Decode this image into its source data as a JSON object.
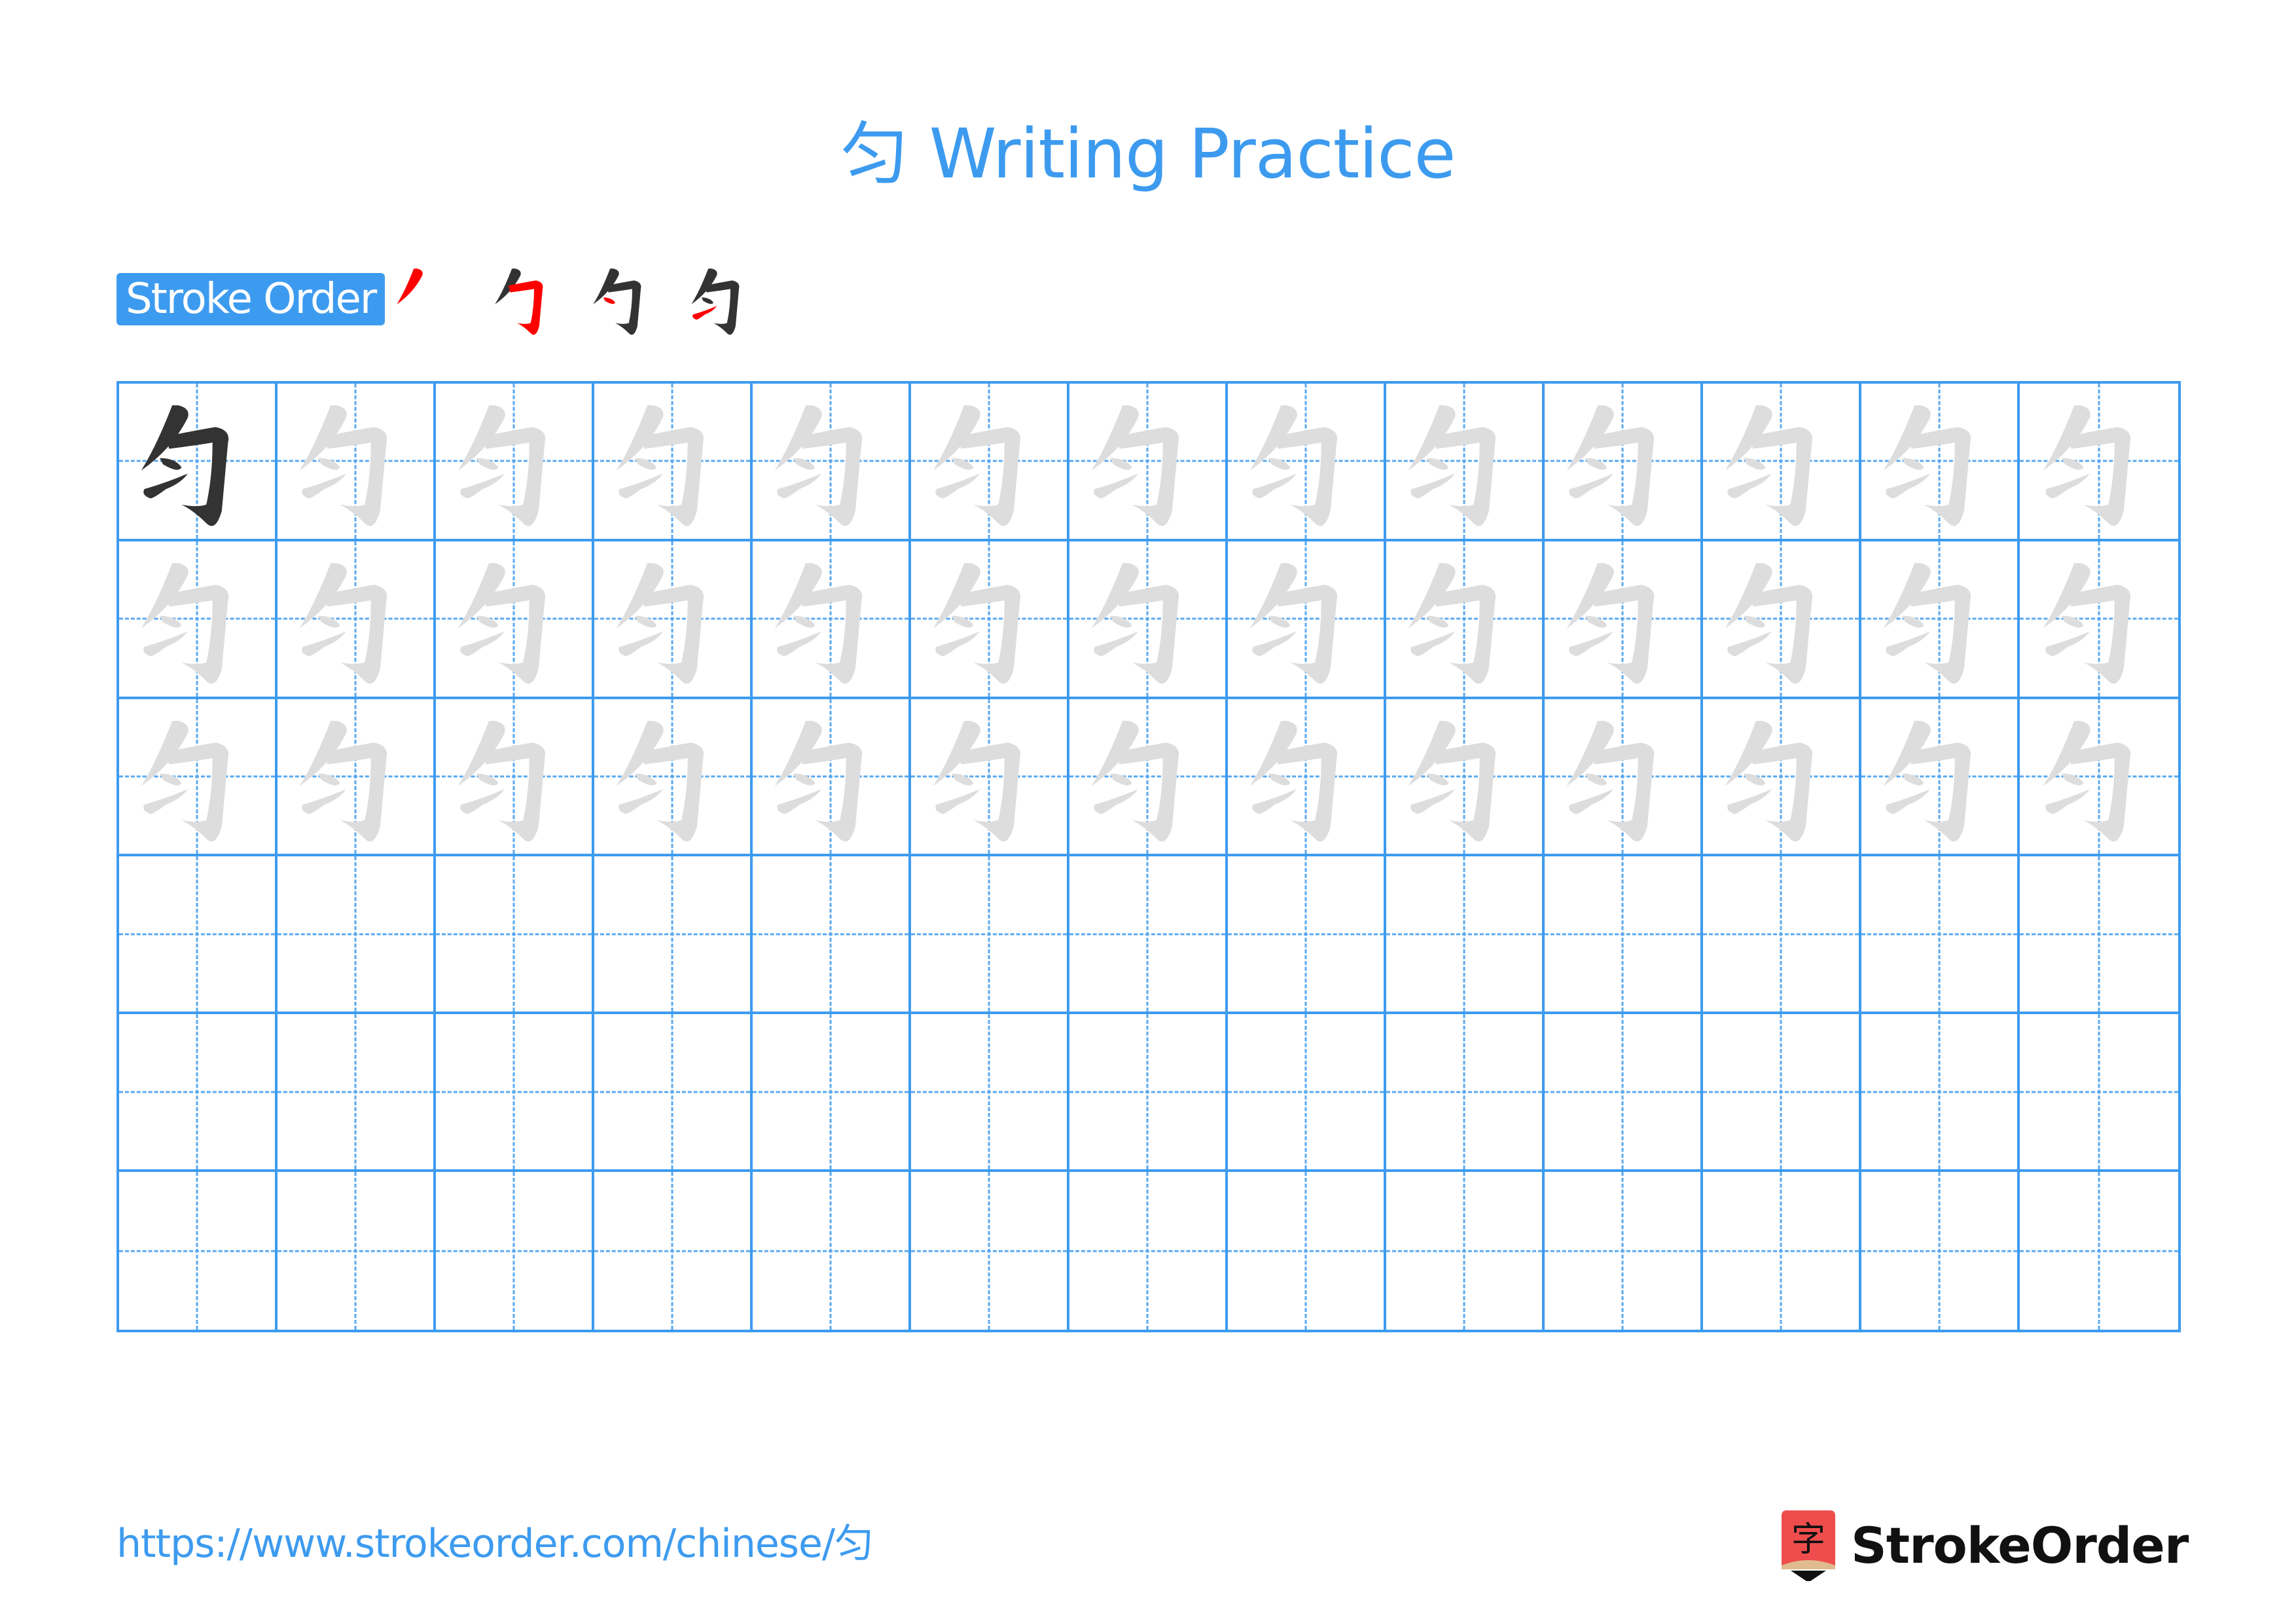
{
  "page": {
    "title": "匀 Writing Practice",
    "character": "匀"
  },
  "stroke_order": {
    "label": "Stroke Order",
    "steps": [
      {
        "step": 1,
        "total_strokes": 4,
        "highlight": "stroke 1"
      },
      {
        "step": 2,
        "total_strokes": 4,
        "highlight": "stroke 2"
      },
      {
        "step": 3,
        "total_strokes": 4,
        "highlight": "stroke 3"
      },
      {
        "step": 4,
        "total_strokes": 4,
        "highlight": "stroke 4"
      }
    ]
  },
  "practice_grid": {
    "columns": 13,
    "rows": 6,
    "rows_with_trace": 3,
    "model_cell_style": "dark",
    "trace_cell_style": "light-grey"
  },
  "footer": {
    "url": "https://www.strokeorder.com/chinese/匀",
    "brand_name": "StrokeOrder",
    "brand_icon_glyph": "字"
  },
  "colors": {
    "accent": "#3d9bef",
    "model_char": "#333333",
    "trace_char": "#dddddd",
    "stroke_highlight": "#ff0000",
    "brand_icon_bg": "#ef4d4d",
    "brand_icon_tip": "#dfbb8f"
  }
}
